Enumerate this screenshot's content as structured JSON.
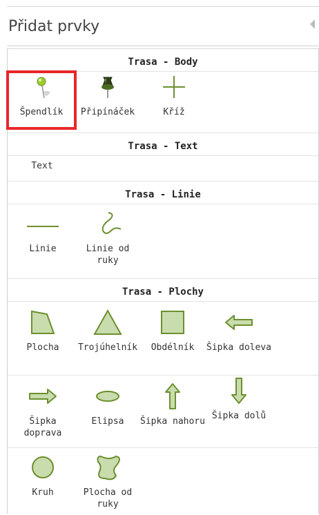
{
  "panel": {
    "title": "Přidat prvky"
  },
  "colors": {
    "shape_stroke": "#6b8f2e",
    "shape_fill": "#c9dcae",
    "selection": "#e8262a"
  },
  "sections": [
    {
      "title": "Trasa - Body",
      "tools": [
        {
          "label": "Špendlík",
          "icon": "pin-icon",
          "selected": true
        },
        {
          "label": "Připínáček",
          "icon": "pushpin-icon"
        },
        {
          "label": "Kříž",
          "icon": "cross-icon"
        }
      ]
    },
    {
      "title": "Trasa - Text",
      "tools": [
        {
          "label": "Text",
          "icon": ""
        }
      ]
    },
    {
      "title": "Trasa - Linie",
      "tools": [
        {
          "label": "Linie",
          "icon": "line-icon"
        },
        {
          "label": "Linie od ruky",
          "icon": "freehand-line-icon"
        }
      ]
    },
    {
      "title": "Trasa - Plochy",
      "tools": [
        {
          "label": "Plocha",
          "icon": "polygon-icon"
        },
        {
          "label": "Trojúhelník",
          "icon": "triangle-icon"
        },
        {
          "label": "Obdélník",
          "icon": "rectangle-icon"
        },
        {
          "label": "Šipka doleva",
          "icon": "arrow-left-icon"
        },
        {
          "label": "Šipka doprava",
          "icon": "arrow-right-icon"
        },
        {
          "label": "Elipsa",
          "icon": "ellipse-icon"
        },
        {
          "label": "Šipka nahoru",
          "icon": "arrow-up-icon"
        },
        {
          "label": "Šipka dolů",
          "icon": "arrow-down-icon"
        },
        {
          "label": "Kruh",
          "icon": "circle-icon"
        },
        {
          "label": "Plocha od ruky",
          "icon": "freehand-polygon-icon"
        }
      ]
    }
  ]
}
